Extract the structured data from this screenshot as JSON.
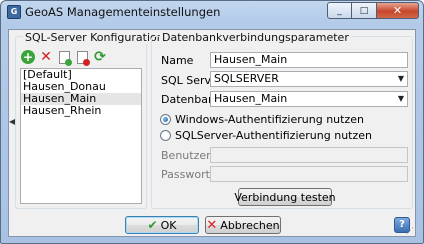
{
  "window": {
    "title": "GeoAS Managementeinstellungen",
    "app_icon_glyph": "G",
    "buttons": {
      "minimize": "_",
      "maximize": "□",
      "close": "✕"
    }
  },
  "left_panel": {
    "title": "SQL-Server Konfigurationen",
    "toolbar_icons": [
      "add-icon",
      "delete-icon",
      "new-document-icon",
      "remove-document-icon",
      "refresh-icon"
    ],
    "toolbar_glyphs": {
      "add": "+",
      "delete": "✕",
      "refresh": "⟳"
    },
    "items": [
      "[Default]",
      "Hausen_Donau",
      "Hausen_Main",
      "Hausen_Rhein"
    ],
    "selected_index": 2,
    "splitter_glyph": "◀"
  },
  "right_panel": {
    "title": "Datenbankverbindungsparameter",
    "name_label": "Name",
    "name_value": "Hausen_Main",
    "sql_server_label": "SQL Server",
    "sql_server_value": "SQLSERVER",
    "database_label": "Datenbank",
    "database_value": "Hausen_Main",
    "combo_arrow": "▼",
    "auth_windows_label": "Windows-Authentifizierung nutzen",
    "auth_sql_label": "SQLServer-Authentifizierung nutzen",
    "auth_selected": "windows",
    "user_label": "Benutzer",
    "user_value": "",
    "password_label": "Passwort",
    "password_value": "",
    "test_button_label": "Verbindung testen"
  },
  "footer": {
    "ok_label": "OK",
    "ok_glyph": "✔",
    "cancel_label": "Abbrechen",
    "cancel_glyph": "✕",
    "help_glyph": "?",
    "grip_glyph": "⋰"
  }
}
